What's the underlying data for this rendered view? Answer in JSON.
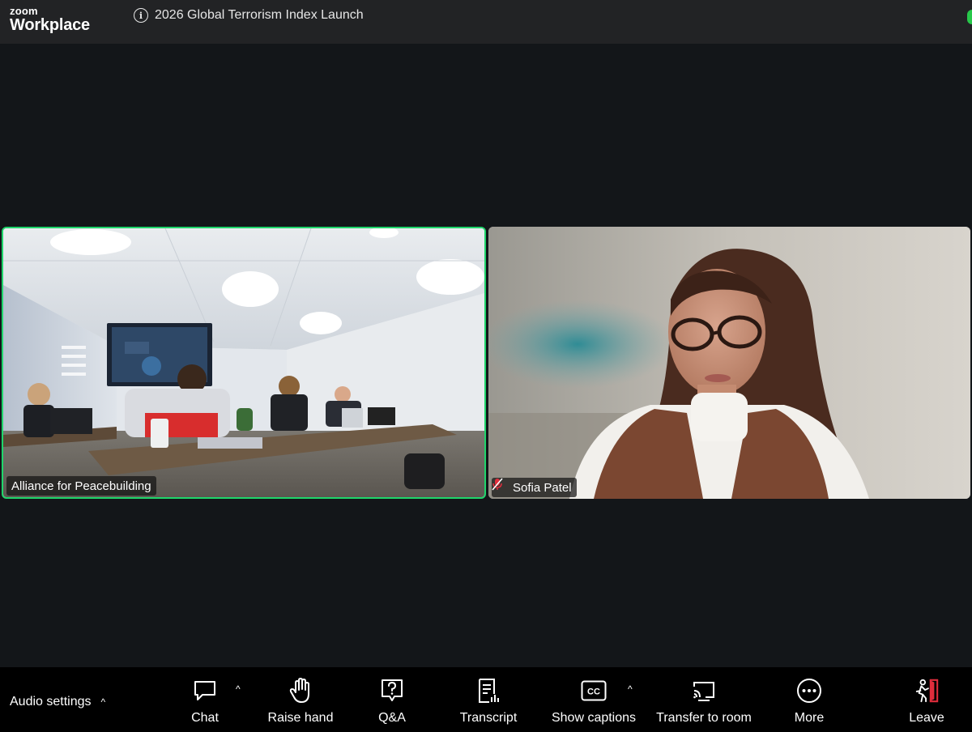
{
  "app": {
    "logo_top": "zoom",
    "logo_bottom": "Workplace"
  },
  "meeting": {
    "title": "2026 Global Terrorism Index Launch"
  },
  "participants": [
    {
      "name": "Alliance for Peacebuilding",
      "active_speaker": true,
      "muted": false
    },
    {
      "name": "Sofia Patel",
      "active_speaker": false,
      "muted": true
    }
  ],
  "toolbar": {
    "audio_settings": "Audio settings",
    "caret": "^",
    "buttons": [
      {
        "label": "Chat",
        "icon": "chat-bubble-icon",
        "has_caret": true
      },
      {
        "label": "Raise hand",
        "icon": "hand-icon",
        "has_caret": false
      },
      {
        "label": "Q&A",
        "icon": "question-bubble-icon",
        "has_caret": false
      },
      {
        "label": "Transcript",
        "icon": "transcript-icon",
        "has_caret": false
      },
      {
        "label": "Show captions",
        "icon": "cc-icon",
        "has_caret": true
      },
      {
        "label": "Transfer to room",
        "icon": "cast-icon",
        "has_caret": false
      },
      {
        "label": "More",
        "icon": "ellipsis-icon",
        "has_caret": false
      },
      {
        "label": "Leave",
        "icon": "leave-door-icon",
        "has_caret": false
      }
    ]
  },
  "colors": {
    "active_speaker_border": "#1fd56b",
    "leave_accent": "#e02d3c",
    "mute_red": "#e02d3c"
  }
}
